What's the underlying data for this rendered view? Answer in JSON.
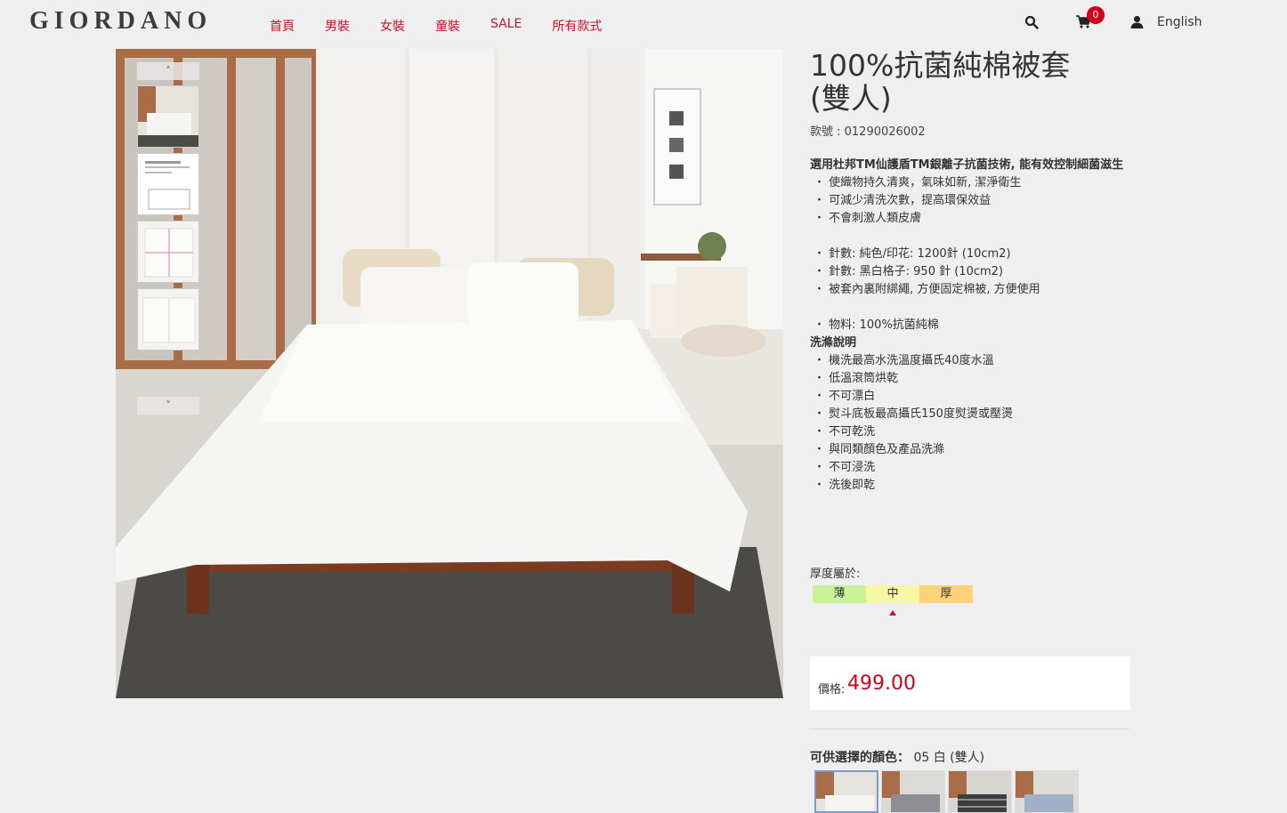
{
  "header": {
    "logo": "GIORDANO",
    "nav": [
      "首頁",
      "男裝",
      "女裝",
      "童裝",
      "SALE",
      "所有款式"
    ],
    "cart_count": "0",
    "language": "English",
    "icons": [
      "search-icon",
      "cart-icon",
      "user-icon"
    ]
  },
  "product": {
    "title_line1": "100%抗菌純棉被套",
    "title_line2": "(雙人)",
    "sku": "款號 : 01290026002",
    "intro": "選用杜邦TM仙護盾TM銀離子抗菌技術, 能有效控制細菌滋生",
    "features": [
      "・ 使織物持久清爽，氣味如新, 潔淨衛生",
      "・ 可減少清洗次數，提高環保效益",
      "・ 不會刺激人類皮膚"
    ],
    "specs": [
      "・ 針數: 純色/印花: 1200針 (10cm2)",
      "・ 針數: 黑白格子: 950 針 (10cm2)",
      "・ 被套內裏附綁繩, 方便固定棉被, 方便使用"
    ],
    "material": "・ 物料: 100%抗菌純棉",
    "care_title": "洗滌說明",
    "care": [
      "・ 機洗最高水洗溫度攝氏40度水溫",
      "・ 低溫滾筒烘乾",
      "・ 不可漂白",
      "・ 熨斗底板最高攝氏150度熨燙或壓燙",
      "・ 不可乾洗",
      "・ 與同類顏色及產品洗滌",
      "・ 不可浸洗",
      "・ 洗後即乾"
    ],
    "thickness_label": "厚度屬於:",
    "thickness_levels": [
      "薄",
      "中",
      "厚"
    ],
    "thickness_selected": "中",
    "thickness_colors": [
      "#c9f29a",
      "#f7f7a4",
      "#fdd27a"
    ],
    "price_label": "價格:",
    "price": "499.00",
    "color_label_prefix": "可供選擇的顏色：",
    "color_selected": "05 白 (雙人)"
  },
  "gallery": {
    "up_arrow": "˄",
    "down_arrow": "˅",
    "thumb_count": 4,
    "swatch_count": 4
  },
  "colors": {
    "accent": "#c8102e",
    "price": "#d0021b"
  }
}
